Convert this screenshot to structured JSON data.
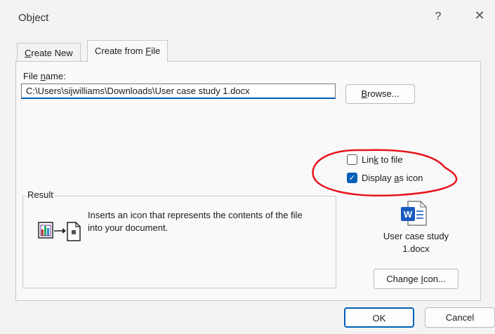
{
  "window": {
    "title": "Object",
    "help_glyph": "?",
    "close_glyph": "✕"
  },
  "tabs": [
    {
      "label_pre": "",
      "label_key": "C",
      "label_post": "reate New",
      "active": false
    },
    {
      "label_pre": "Create from ",
      "label_key": "F",
      "label_post": "ile",
      "active": true
    }
  ],
  "file": {
    "label_pre": "File ",
    "label_key": "n",
    "label_post": "ame:",
    "value": "C:\\Users\\sijwilliams\\Downloads\\User case study 1.docx"
  },
  "browse": {
    "pre": "",
    "key": "B",
    "post": "rowse..."
  },
  "options": {
    "link": {
      "pre": "Lin",
      "key": "k",
      "post": " to file",
      "checked": false
    },
    "display_icon": {
      "pre": "Display ",
      "key": "a",
      "post": "s icon",
      "checked": true
    }
  },
  "result": {
    "label": "Result",
    "text": "Inserts an icon that represents the contents of the file into your document."
  },
  "icon_preview": {
    "caption_line1": "User case study",
    "caption_line2": "1.docx"
  },
  "change_icon": {
    "pre": "Change ",
    "key": "I",
    "post": "con..."
  },
  "buttons": {
    "ok": "OK",
    "cancel": "Cancel"
  },
  "colors": {
    "accent": "#005fb8",
    "annotation": "#e8141c",
    "word_blue": "#185abd"
  }
}
